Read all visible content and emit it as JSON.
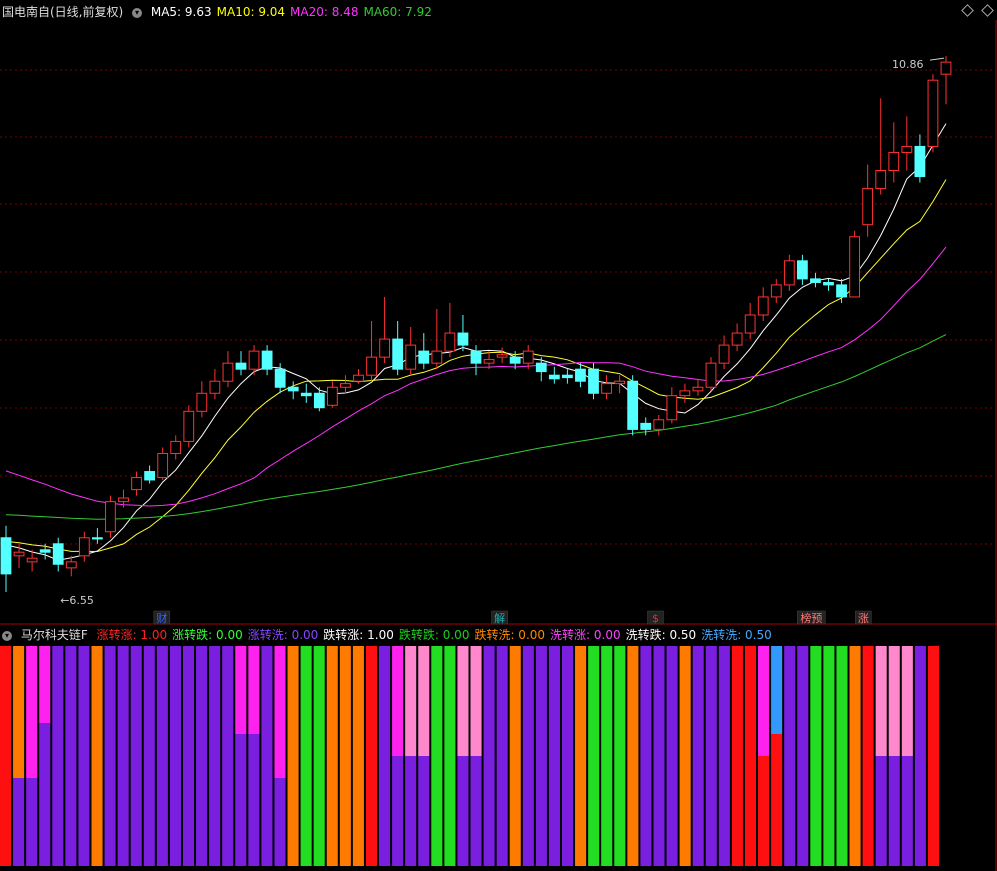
{
  "header": {
    "stock_title": "国电南自(日线,前复权)",
    "ma_labels": [
      {
        "text": "MA5: 9.63",
        "color": "#ffffff"
      },
      {
        "text": "MA10: 9.04",
        "color": "#ffff00"
      },
      {
        "text": "MA20: 8.48",
        "color": "#ff33ff"
      },
      {
        "text": "MA60: 7.92",
        "color": "#33cc33"
      }
    ]
  },
  "indicator_header": {
    "title": "马尔科夫链F",
    "items": [
      {
        "text": "涨转涨: 1.00",
        "color": "#ff2222"
      },
      {
        "text": "涨转跌: 0.00",
        "color": "#33ff33"
      },
      {
        "text": "涨转洗: 0.00",
        "color": "#8844ff"
      },
      {
        "text": "跌转涨: 1.00",
        "color": "#ffffff"
      },
      {
        "text": "跌转跌: 0.00",
        "color": "#22cc22"
      },
      {
        "text": "跌转洗: 0.00",
        "color": "#ff8800"
      },
      {
        "text": "洗转涨: 0.00",
        "color": "#ff44ff"
      },
      {
        "text": "洗转跌: 0.50",
        "color": "#ffffff"
      },
      {
        "text": "洗转洗: 0.50",
        "color": "#44aaff"
      }
    ]
  },
  "chart_data": {
    "type": "candlestick",
    "price_annotations": {
      "high_label": "10.86",
      "low_label": "6.55"
    },
    "event_markers": [
      {
        "text": "财",
        "color": "#3366ff",
        "index": 12
      },
      {
        "text": "解",
        "color": "#22aaaa",
        "index": 38
      },
      {
        "text": "$",
        "color": "#ff2222",
        "index": 50
      },
      {
        "text": "榜预",
        "color": "#ff7777",
        "index": 62
      },
      {
        "text": "涨",
        "color": "#ff7777",
        "index": 66
      }
    ],
    "candles": [
      [
        7.0,
        6.7,
        7.1,
        6.55
      ],
      [
        6.85,
        6.88,
        6.95,
        6.75
      ],
      [
        6.8,
        6.83,
        6.9,
        6.72
      ],
      [
        6.9,
        6.88,
        6.95,
        6.82
      ],
      [
        6.95,
        6.78,
        7.0,
        6.72
      ],
      [
        6.75,
        6.8,
        6.85,
        6.68
      ],
      [
        6.85,
        7.0,
        7.05,
        6.8
      ],
      [
        7.0,
        6.99,
        7.08,
        6.95
      ],
      [
        7.05,
        7.3,
        7.35,
        7.0
      ],
      [
        7.3,
        7.33,
        7.4,
        7.25
      ],
      [
        7.4,
        7.5,
        7.55,
        7.35
      ],
      [
        7.55,
        7.48,
        7.6,
        7.45
      ],
      [
        7.5,
        7.7,
        7.75,
        7.48
      ],
      [
        7.7,
        7.8,
        7.85,
        7.65
      ],
      [
        7.8,
        8.05,
        8.1,
        7.75
      ],
      [
        8.05,
        8.2,
        8.3,
        8.0
      ],
      [
        8.2,
        8.3,
        8.4,
        8.15
      ],
      [
        8.3,
        8.45,
        8.55,
        8.25
      ],
      [
        8.45,
        8.4,
        8.55,
        8.35
      ],
      [
        8.4,
        8.55,
        8.6,
        8.35
      ],
      [
        8.55,
        8.4,
        8.6,
        8.35
      ],
      [
        8.4,
        8.25,
        8.45,
        8.2
      ],
      [
        8.25,
        8.22,
        8.3,
        8.15
      ],
      [
        8.2,
        8.18,
        8.28,
        8.12
      ],
      [
        8.2,
        8.08,
        8.25,
        8.05
      ],
      [
        8.1,
        8.25,
        8.3,
        8.08
      ],
      [
        8.25,
        8.28,
        8.35,
        8.2
      ],
      [
        8.3,
        8.35,
        8.4,
        8.28
      ],
      [
        8.35,
        8.5,
        8.8,
        8.3
      ],
      [
        8.5,
        8.65,
        9.0,
        8.45
      ],
      [
        8.65,
        8.4,
        8.8,
        8.35
      ],
      [
        8.4,
        8.6,
        8.75,
        8.35
      ],
      [
        8.55,
        8.45,
        8.7,
        8.4
      ],
      [
        8.45,
        8.55,
        8.9,
        8.4
      ],
      [
        8.55,
        8.7,
        8.95,
        8.5
      ],
      [
        8.7,
        8.6,
        8.85,
        8.55
      ],
      [
        8.55,
        8.45,
        8.6,
        8.35
      ],
      [
        8.45,
        8.48,
        8.55,
        8.4
      ],
      [
        8.5,
        8.52,
        8.58,
        8.45
      ],
      [
        8.5,
        8.45,
        8.55,
        8.4
      ],
      [
        8.45,
        8.55,
        8.6,
        8.4
      ],
      [
        8.45,
        8.38,
        8.5,
        8.3
      ],
      [
        8.35,
        8.32,
        8.42,
        8.28
      ],
      [
        8.35,
        8.33,
        8.4,
        8.28
      ],
      [
        8.4,
        8.3,
        8.45,
        8.25
      ],
      [
        8.4,
        8.2,
        8.45,
        8.15
      ],
      [
        8.2,
        8.28,
        8.35,
        8.15
      ],
      [
        8.28,
        8.3,
        8.35,
        8.2
      ],
      [
        8.3,
        7.9,
        8.35,
        7.85
      ],
      [
        7.95,
        7.9,
        8.0,
        7.85
      ],
      [
        7.9,
        7.98,
        8.02,
        7.85
      ],
      [
        7.98,
        8.18,
        8.25,
        7.95
      ],
      [
        8.18,
        8.22,
        8.28,
        8.12
      ],
      [
        8.22,
        8.25,
        8.32,
        8.18
      ],
      [
        8.25,
        8.45,
        8.5,
        8.22
      ],
      [
        8.45,
        8.6,
        8.68,
        8.4
      ],
      [
        8.6,
        8.7,
        8.78,
        8.55
      ],
      [
        8.7,
        8.85,
        8.95,
        8.65
      ],
      [
        8.85,
        9.0,
        9.08,
        8.8
      ],
      [
        9.0,
        9.1,
        9.15,
        8.95
      ],
      [
        9.1,
        9.3,
        9.35,
        9.05
      ],
      [
        9.3,
        9.15,
        9.35,
        9.1
      ],
      [
        9.15,
        9.12,
        9.2,
        9.08
      ],
      [
        9.12,
        9.1,
        9.15,
        9.05
      ],
      [
        9.1,
        9.0,
        9.15,
        8.95
      ],
      [
        9.0,
        9.5,
        9.55,
        9.0
      ],
      [
        9.6,
        9.9,
        10.1,
        9.5
      ],
      [
        9.9,
        10.05,
        10.65,
        9.85
      ],
      [
        10.05,
        10.2,
        10.45,
        9.95
      ],
      [
        10.2,
        10.25,
        10.5,
        10.05
      ],
      [
        10.25,
        10.0,
        10.35,
        9.95
      ],
      [
        10.25,
        10.8,
        10.85,
        10.2
      ],
      [
        10.85,
        10.95,
        11.0,
        10.6
      ]
    ],
    "ma_series": [
      "MA5",
      "MA10",
      "MA20",
      "MA60"
    ],
    "markov_bars": [
      [
        "#ff1010"
      ],
      [
        [
          "#ff7a00",
          0.6
        ],
        [
          "#7a1fe0",
          0.4
        ]
      ],
      [
        [
          "#ff22ee",
          0.6
        ],
        [
          "#7a1fe0",
          0.4
        ]
      ],
      [
        [
          "#ff22ee",
          0.35
        ],
        [
          "#7a1fe0",
          0.65
        ]
      ],
      [
        "#7a1fe0"
      ],
      [
        "#7a1fe0"
      ],
      [
        "#7a1fe0"
      ],
      [
        "#ff7a00"
      ],
      [
        "#7a1fe0"
      ],
      [
        "#7a1fe0"
      ],
      [
        "#7a1fe0"
      ],
      [
        "#7a1fe0"
      ],
      [
        "#7a1fe0"
      ],
      [
        "#7a1fe0"
      ],
      [
        "#7a1fe0"
      ],
      [
        [
          "#7a1fe0",
          0.6
        ],
        [
          "#7a1fe0",
          0.4
        ]
      ],
      [
        "#7a1fe0"
      ],
      [
        "#7a1fe0"
      ],
      [
        [
          "#ff22ee",
          0.4
        ],
        [
          "#7a1fe0",
          0.6
        ]
      ],
      [
        [
          "#ff22ee",
          0.4
        ],
        [
          "#7a1fe0",
          0.6
        ]
      ],
      [
        "#7a1fe0"
      ],
      [
        [
          "#ff22ee",
          0.6
        ],
        [
          "#7a1fe0",
          0.4
        ]
      ],
      [
        "#ff7a00"
      ],
      [
        "#22dd22"
      ],
      [
        "#22dd22"
      ],
      [
        "#ff7a00"
      ],
      [
        "#ff7a00"
      ],
      [
        "#ff7a00"
      ],
      [
        "#ff1010"
      ],
      [
        "#7a1fe0"
      ],
      [
        [
          "#ff22ee",
          0.5
        ],
        [
          "#7a1fe0",
          0.5
        ]
      ],
      [
        [
          "#ff88cc",
          0.5
        ],
        [
          "#7a1fe0",
          0.5
        ]
      ],
      [
        [
          "#ff88cc",
          0.5
        ],
        [
          "#7a1fe0",
          0.5
        ]
      ],
      [
        "#22dd22"
      ],
      [
        "#22dd22"
      ],
      [
        [
          "#ff88cc",
          0.5
        ],
        [
          "#7a1fe0",
          0.5
        ]
      ],
      [
        [
          "#ff88cc",
          0.5
        ],
        [
          "#7a1fe0",
          0.5
        ]
      ],
      [
        "#7a1fe0"
      ],
      [
        "#7a1fe0"
      ],
      [
        "#ff7a00"
      ],
      [
        "#7a1fe0"
      ],
      [
        "#7a1fe0"
      ],
      [
        "#7a1fe0"
      ],
      [
        "#7a1fe0"
      ],
      [
        "#ff7a00"
      ],
      [
        "#22dd22"
      ],
      [
        "#22dd22"
      ],
      [
        "#22dd22"
      ],
      [
        "#ff7a00"
      ],
      [
        "#7a1fe0"
      ],
      [
        "#7a1fe0"
      ],
      [
        "#7a1fe0"
      ],
      [
        "#ff7a00"
      ],
      [
        "#7a1fe0"
      ],
      [
        "#7a1fe0"
      ],
      [
        "#7a1fe0"
      ],
      [
        "#ff1010"
      ],
      [
        "#ff1010"
      ],
      [
        [
          "#ff22ee",
          0.5
        ],
        [
          "#ff1010",
          0.5
        ]
      ],
      [
        [
          "#3399ff",
          0.4
        ],
        [
          "#ff1010",
          0.6
        ]
      ],
      [
        "#7a1fe0"
      ],
      [
        "#7a1fe0"
      ],
      [
        "#22dd22"
      ],
      [
        "#22dd22"
      ],
      [
        "#22dd22"
      ],
      [
        "#ff7a00"
      ],
      [
        "#ff1010"
      ],
      [
        [
          "#ff88cc",
          0.5
        ],
        [
          "#7a1fe0",
          0.5
        ]
      ],
      [
        [
          "#ff88cc",
          0.5
        ],
        [
          "#7a1fe0",
          0.5
        ]
      ],
      [
        [
          "#ff88cc",
          0.5
        ],
        [
          "#7a1fe0",
          0.5
        ]
      ],
      [
        "#7a1fe0"
      ],
      [
        "#ff1010"
      ]
    ]
  }
}
